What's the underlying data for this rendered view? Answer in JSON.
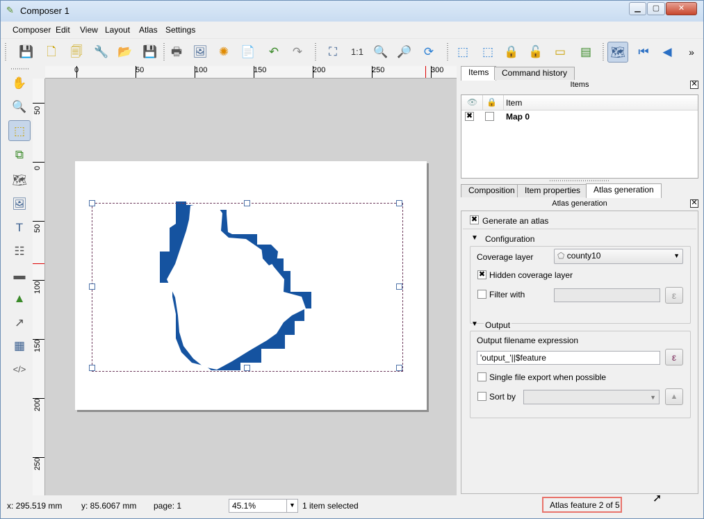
{
  "window": {
    "title": "Composer 1",
    "app_icon": "qgis-composer-icon"
  },
  "menu": [
    "Composer",
    "Edit",
    "View",
    "Layout",
    "Atlas",
    "Settings"
  ],
  "ruler_h": [
    "0",
    "50",
    "100",
    "150",
    "200",
    "250",
    "300"
  ],
  "ruler_v": [
    "50",
    "0",
    "50",
    "100",
    "150",
    "200",
    "250"
  ],
  "panel": {
    "tabs_top": [
      "Items",
      "Command history"
    ],
    "items_header": "Items",
    "items_columns": [
      "Item"
    ],
    "items_rows": [
      {
        "name": "Map 0",
        "visible": true,
        "locked": false
      }
    ],
    "tabs_bottom": [
      "Composition",
      "Item properties",
      "Atlas generation"
    ],
    "atlas_header": "Atlas generation",
    "generate_atlas": "Generate an atlas",
    "configuration": "Configuration",
    "coverage_label": "Coverage layer",
    "coverage_value": "county10",
    "hidden_coverage": "Hidden coverage layer",
    "filter_with": "Filter with",
    "output": "Output",
    "output_expr_label": "Output filename expression",
    "output_expr_value": "'output_'||$feature",
    "single_file": "Single file export when possible",
    "sort_by": "Sort by"
  },
  "status": {
    "x": "x: 295.519 mm",
    "y": "y: 85.6067 mm",
    "page": "page: 1",
    "zoom": "45.1%",
    "selected": "1 item selected",
    "atlas_feature": "Atlas feature 2 of 5"
  },
  "colors": {
    "map_fill": "#1553a0",
    "highlight": "#e8726a"
  }
}
